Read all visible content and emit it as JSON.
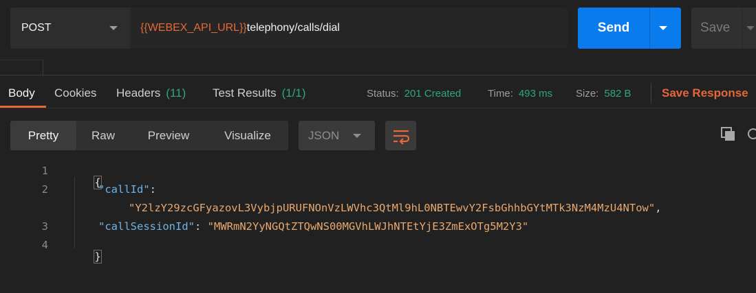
{
  "request": {
    "method": "POST",
    "url_variable": "{{WEBEX_API_URL}}",
    "url_path": "telephony/calls/dial",
    "send_label": "Send",
    "save_label": "Save"
  },
  "response_tabs": [
    {
      "label": "Body",
      "count": ""
    },
    {
      "label": "Cookies",
      "count": ""
    },
    {
      "label": "Headers",
      "count": "(11)"
    },
    {
      "label": "Test Results",
      "count": "(1/1)"
    }
  ],
  "status": {
    "status_label": "Status:",
    "status_value": "201 Created",
    "time_label": "Time:",
    "time_value": "493 ms",
    "size_label": "Size:",
    "size_value": "582 B",
    "save_response": "Save Response"
  },
  "format_tabs": [
    "Pretty",
    "Raw",
    "Preview",
    "Visualize"
  ],
  "format_select": "JSON",
  "code": {
    "line_numbers": [
      "1",
      "2",
      "3",
      "4"
    ],
    "open_brace": "{",
    "close_brace": "}",
    "key1": "\"callId\"",
    "value1": "\"Y2lzY29zcGFyazovL3VybjpURUFNOnVzLWVhc3QtMl9hL0NBTEwvY2FsbGhhbGYtMTk3NzM4MzU4NTow\"",
    "key2": "\"callSessionId\"",
    "value2": "\"MWRmN2YyNGQtZTQwNS00MGVhLWJhNTEtYjE3ZmExOTg5M2Y3\"",
    "colon": ":",
    "comma": ","
  },
  "colors": {
    "accent_orange": "#e5673a",
    "send_blue": "#097bed",
    "success_green": "#2ea87a",
    "json_key": "#6fb3e8",
    "json_string": "#e8a86f"
  },
  "icons": [
    "chevron-down-icon",
    "wrap-lines-icon",
    "copy-icon",
    "search-icon"
  ]
}
